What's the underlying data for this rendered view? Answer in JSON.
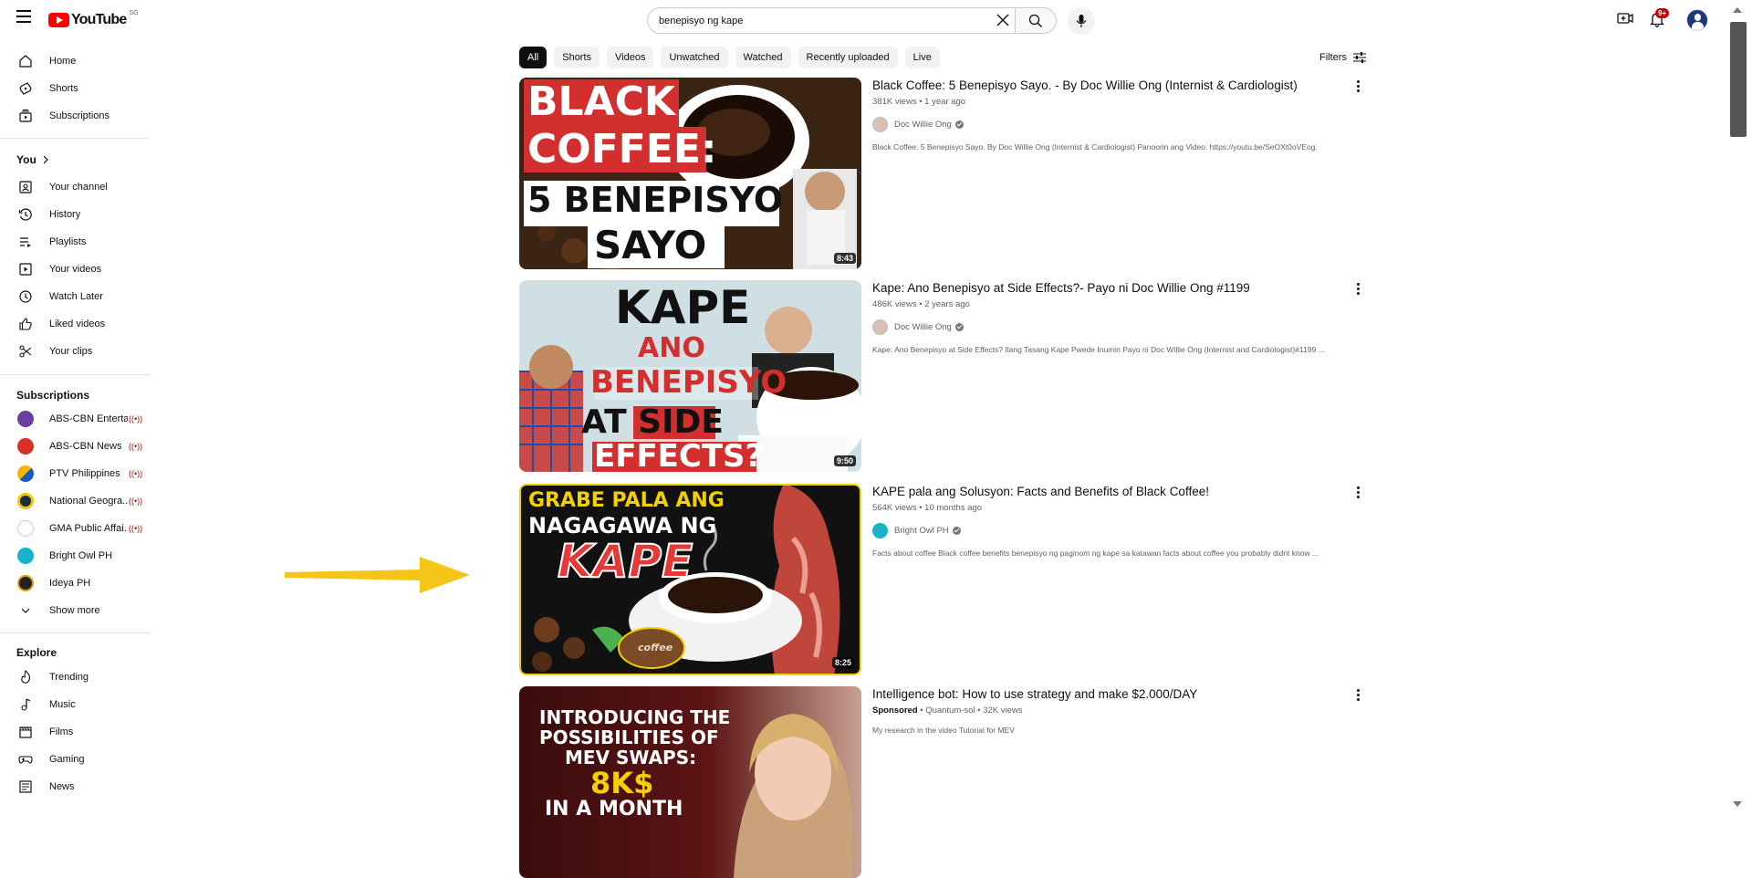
{
  "header": {
    "logo_text": "YouTube",
    "country_code": "SG",
    "search_value": "benepisyo ng kape",
    "notification_count": "9+"
  },
  "sidebar": {
    "main": [
      {
        "label": "Home",
        "icon": "home-icon"
      },
      {
        "label": "Shorts",
        "icon": "shorts-icon"
      },
      {
        "label": "Subscriptions",
        "icon": "subscriptions-icon"
      }
    ],
    "you_heading": "You",
    "you": [
      {
        "label": "Your channel",
        "icon": "your-channel-icon"
      },
      {
        "label": "History",
        "icon": "history-icon"
      },
      {
        "label": "Playlists",
        "icon": "playlists-icon"
      },
      {
        "label": "Your videos",
        "icon": "your-videos-icon"
      },
      {
        "label": "Watch Later",
        "icon": "watch-later-icon"
      },
      {
        "label": "Liked videos",
        "icon": "liked-videos-icon"
      },
      {
        "label": "Your clips",
        "icon": "clips-icon"
      }
    ],
    "subscriptions_heading": "Subscriptions",
    "subscriptions": [
      {
        "label": "ABS-CBN Enterta...",
        "live": true,
        "color": "#6a3fa0"
      },
      {
        "label": "ABS-CBN News",
        "live": true,
        "color": "#d93025"
      },
      {
        "label": "PTV Philippines",
        "live": true,
        "color": "#f4b400"
      },
      {
        "label": "National Geogra...",
        "live": true,
        "color": "#1c2a4a"
      },
      {
        "label": "GMA Public Affai...",
        "live": true,
        "color": "#e35b45"
      },
      {
        "label": "Bright Owl PH",
        "live": false,
        "color": "#18b4c9"
      },
      {
        "label": "Ideya PH",
        "live": false,
        "color": "#222222"
      }
    ],
    "show_more": "Show more",
    "explore_heading": "Explore",
    "explore": [
      {
        "label": "Trending",
        "icon": "trending-icon"
      },
      {
        "label": "Music",
        "icon": "music-icon"
      },
      {
        "label": "Films",
        "icon": "films-icon"
      },
      {
        "label": "Gaming",
        "icon": "gaming-icon"
      },
      {
        "label": "News",
        "icon": "news-icon"
      }
    ]
  },
  "chips": [
    "All",
    "Shorts",
    "Videos",
    "Unwatched",
    "Watched",
    "Recently uploaded",
    "Live"
  ],
  "filters_label": "Filters",
  "results": [
    {
      "title": "Black Coffee: 5 Benepisyo Sayo. - By Doc Willie Ong (Internist & Cardiologist)",
      "meta": "381K views • 1 year ago",
      "channel": "Doc Willie Ong",
      "description": "Black Coffee: 5 Benepisyo Sayo. By Doc Willie Ong (Internist & Cardiologist) Panoorin ang Video: https://youtu.be/SeOXt0oVEog.",
      "duration": "8:43",
      "thumb_lines": [
        "BLACK",
        "COFFEE:",
        "5 BENEPISYO",
        "SAYO"
      ]
    },
    {
      "title": "Kape: Ano Benepisyo at Side Effects?- Payo ni Doc Willie Ong #1199",
      "meta": "486K views • 2 years ago",
      "channel": "Doc Willie Ong",
      "description": "Kape: Ano Benepisyo at Side Effects? Ilang Tasang Kape Pwede Inumin Payo ni Doc Willie Ong (Internist and Cardiologist)#1199 ...",
      "duration": "9:50",
      "thumb_lines": [
        "KAPE",
        "ANO",
        "BENEPISYO",
        "AT SIDE",
        "EFFECTS?"
      ]
    },
    {
      "title": "KAPE pala ang Solusyon: Facts and Benefits of Black Coffee!",
      "meta": "564K views • 10 months ago",
      "channel": "Bright Owl PH",
      "description": "Facts about coffee Black coffee benefits benepisyo ng paginom ng kape sa katawan facts about coffee you probably didnt know ...",
      "duration": "8:25",
      "thumb_lines": [
        "GRABE PALA ANG",
        "NAGAGAWA NG",
        "KAPE",
        "coffee"
      ]
    },
    {
      "title": "Intelligence bot: How to use strategy and make $2.000/DAY",
      "sponsored": "Sponsored",
      "meta": " • Quantum-sol • 32K views",
      "description": "My research in the video Tutorial for MEV",
      "thumb_lines": [
        "INTRODUCING THE",
        "POSSIBILITIES OF",
        "MEV SWAPS:",
        "8K$",
        "IN A MONTH"
      ]
    }
  ]
}
